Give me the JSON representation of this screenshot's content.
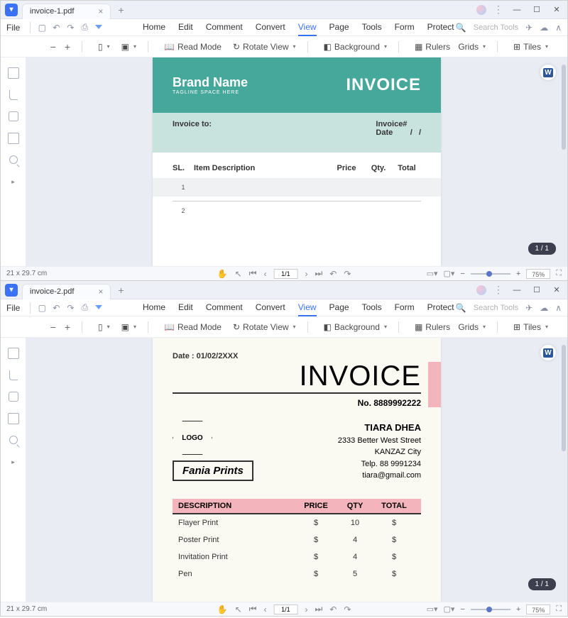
{
  "win1": {
    "tab_title": "invoice-1.pdf",
    "file": "File",
    "menu": {
      "home": "Home",
      "edit": "Edit",
      "comment": "Comment",
      "convert": "Convert",
      "view": "View",
      "page": "Page",
      "tools": "Tools",
      "form": "Form",
      "protect": "Protect"
    },
    "search_ph": "Search Tools",
    "toolbar": {
      "read": "Read Mode",
      "rotate": "Rotate View",
      "bg": "Background",
      "rulers": "Rulers",
      "grids": "Grids",
      "tiles": "Tiles"
    },
    "status_dim": "21 x 29.7 cm",
    "page_input": "1/1",
    "zoom": "75%",
    "page_badge": "1 / 1"
  },
  "win2": {
    "tab_title": "invoice-2.pdf",
    "file": "File",
    "menu": {
      "home": "Home",
      "edit": "Edit",
      "comment": "Comment",
      "convert": "Convert",
      "view": "View",
      "page": "Page",
      "tools": "Tools",
      "form": "Form",
      "protect": "Protect"
    },
    "search_ph": "Search Tools",
    "toolbar": {
      "read": "Read Mode",
      "rotate": "Rotate View",
      "bg": "Background",
      "rulers": "Rulers",
      "grids": "Grids",
      "tiles": "Tiles"
    },
    "status_dim": "21 x 29.7 cm",
    "page_input": "1/1",
    "zoom": "75%",
    "page_badge": "1 / 1"
  },
  "doc1": {
    "brand": "Brand Name",
    "tagline": "TAGLINE SPACE HERE",
    "invoice": "INVOICE",
    "inv_to": "Invoice to:",
    "inv_num": "Invoice#",
    "date": "Date",
    "slash1": "/",
    "slash2": "/",
    "h_sl": "SL.",
    "h_desc": "Item Description",
    "h_price": "Price",
    "h_qty": "Qty.",
    "h_tot": "Total",
    "r1": "1",
    "r2": "2"
  },
  "doc2": {
    "date": "Date : 01/02/2XXX",
    "inv": "INVOICE",
    "no": "No. 8889992222",
    "logo": "LOGO",
    "fania": "Fania Prints",
    "name": "TIARA DHEA",
    "addr1": "2333 Better West Street",
    "addr2": "KANZAZ City",
    "tel": "Telp. 88 9991234",
    "email": "tiara@gmail.com",
    "th_d": "DESCRIPTION",
    "th_p": "PRICE",
    "th_q": "QTY",
    "th_t": "TOTAL",
    "rows": [
      {
        "d": "Flayer Print",
        "p": "$",
        "q": "10",
        "t": "$"
      },
      {
        "d": "Poster Print",
        "p": "$",
        "q": "4",
        "t": "$"
      },
      {
        "d": "Invitation Print",
        "p": "$",
        "q": "4",
        "t": "$"
      },
      {
        "d": "Pen",
        "p": "$",
        "q": "5",
        "t": "$"
      }
    ]
  }
}
